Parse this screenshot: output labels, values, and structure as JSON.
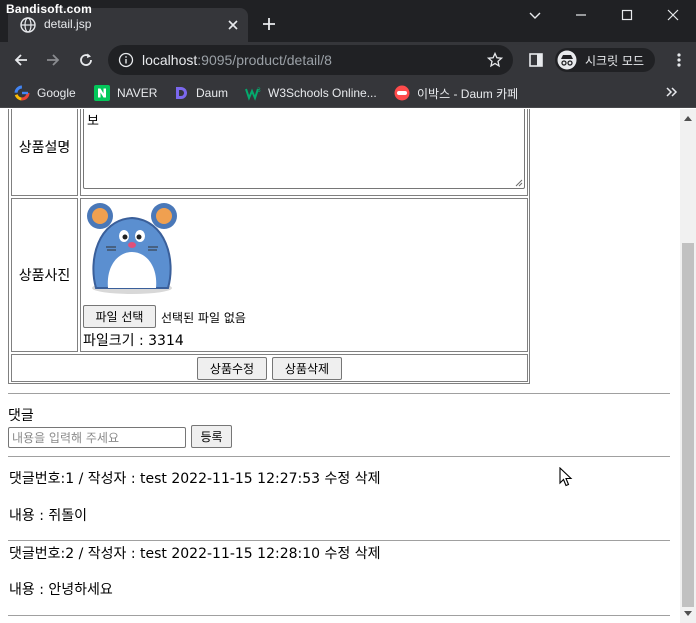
{
  "watermark": "Bandisoft.com",
  "tab": {
    "title": "detail.jsp"
  },
  "address": {
    "host": "localhost",
    "rest": ":9095/product/detail/8"
  },
  "profile": {
    "label": "시크릿 모드"
  },
  "bookmarks": [
    {
      "label": "Google",
      "icon": "google-icon"
    },
    {
      "label": "NAVER",
      "icon": "naver-icon"
    },
    {
      "label": "Daum",
      "icon": "daum-icon"
    },
    {
      "label": "W3Schools Online...",
      "icon": "w3schools-icon"
    },
    {
      "label": "이박스 - Daum 카페",
      "icon": "daum-cafe-icon"
    }
  ],
  "product": {
    "desc_label": "상품설명",
    "desc_text": "보",
    "photo_label": "상품사진",
    "file_button": "파일 선택",
    "no_file": "선택된 파일 없음",
    "file_size": "파일크기 : 3314",
    "edit_button": "상품수정",
    "delete_button": "상품삭제"
  },
  "comments": {
    "heading": "댓글",
    "placeholder": "내용을 입력해 주세요",
    "submit": "등록",
    "list": [
      {
        "header": "댓글번호:1 / 작성자 : test 2022-11-15 12:27:53",
        "edit": "수정",
        "delete": "삭제",
        "body": "내용 : 쥐돌이"
      },
      {
        "header": "댓글번호:2 / 작성자 : test 2022-11-15 12:28:10",
        "edit": "수정",
        "delete": "삭제",
        "body": "내용 : 안녕하세요"
      }
    ]
  },
  "colors": {
    "chrome_dark": "#202124",
    "chrome_tab": "#35363a",
    "naver_green": "#03c75a"
  }
}
